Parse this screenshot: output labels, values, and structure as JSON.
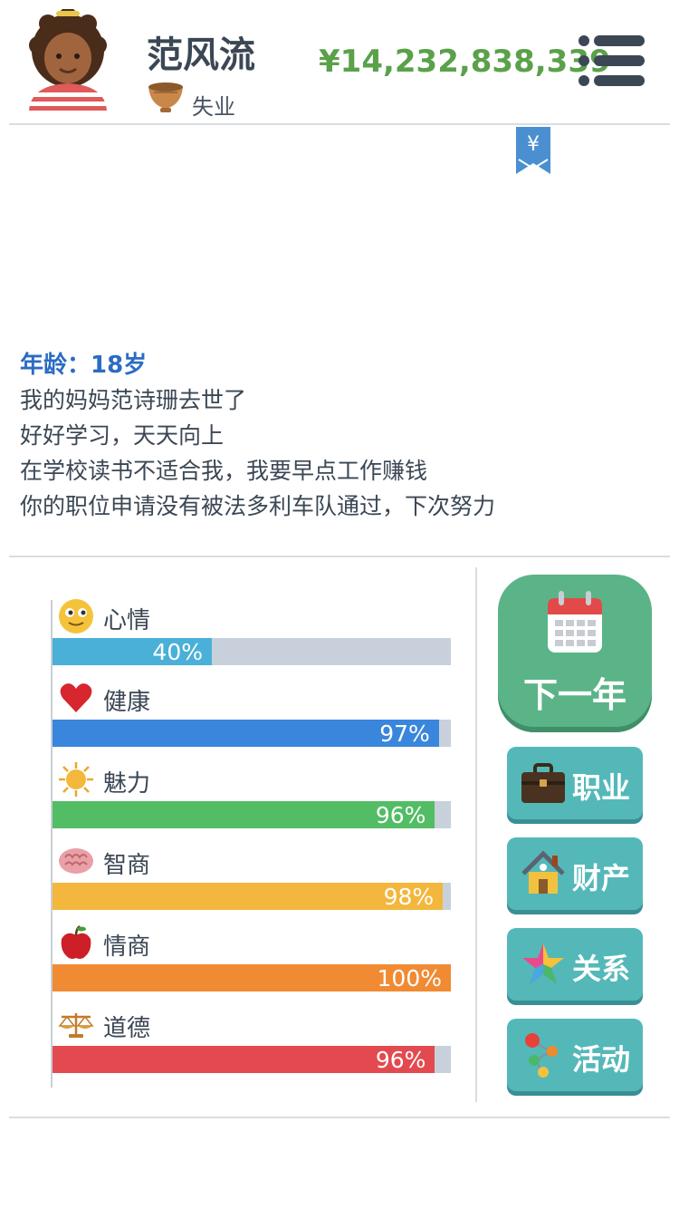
{
  "header": {
    "name": "范风流",
    "job": "失业",
    "money": "¥14,232,838,339"
  },
  "bookmark": {
    "symbol": "¥"
  },
  "log": {
    "age": "年龄：18岁",
    "lines": [
      "我的妈妈范诗珊去世了",
      "好好学习，天天向上",
      "在学校读书不适合我，我要早点工作赚钱",
      "你的职位申请没有被法多利车队通过，下次努力"
    ]
  },
  "stats": [
    {
      "label": "心情",
      "value": 40,
      "text": "40%",
      "color": "#4ab0d8",
      "icon": "smiley-icon"
    },
    {
      "label": "健康",
      "value": 97,
      "text": "97%",
      "color": "#3a86dc",
      "icon": "heart-icon"
    },
    {
      "label": "魅力",
      "value": 96,
      "text": "96%",
      "color": "#52bd64",
      "icon": "sun-icon"
    },
    {
      "label": "智商",
      "value": 98,
      "text": "98%",
      "color": "#f3b73d",
      "icon": "brain-icon"
    },
    {
      "label": "情商",
      "value": 100,
      "text": "100%",
      "color": "#f08b34",
      "icon": "apple-icon"
    },
    {
      "label": "道德",
      "value": 96,
      "text": "96%",
      "color": "#e34a4f",
      "icon": "scales-icon"
    }
  ],
  "buttons": {
    "next_year": "下一年",
    "career": "职业",
    "assets": "财产",
    "relations": "关系",
    "activities": "活动"
  }
}
